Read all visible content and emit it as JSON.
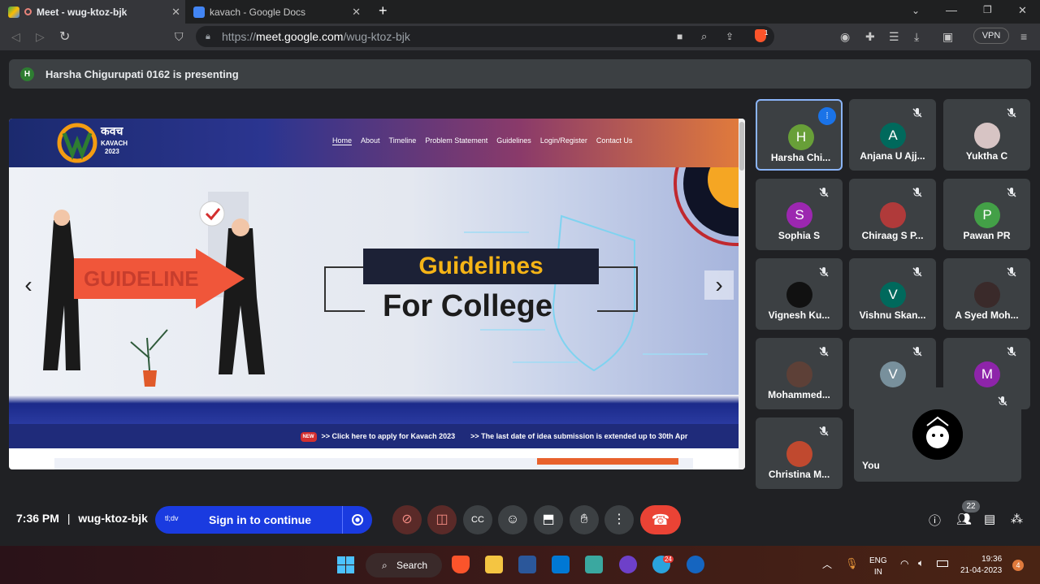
{
  "browser": {
    "tabs": [
      {
        "title": "Meet - wug-ktoz-bjk",
        "active": true
      },
      {
        "title": "kavach - Google Docs",
        "active": false
      }
    ],
    "new_tab_label": "+",
    "url_prefix": "https://",
    "url_host": "meet.google.com",
    "url_path": "/wug-ktoz-bjk",
    "vpn_label": "VPN",
    "shield_count": "1"
  },
  "banner": {
    "avatar_letter": "H",
    "text": "Harsha Chigurupati 0162 is presenting"
  },
  "slide": {
    "logo_title": "कवच",
    "logo_sub": "KAVACH",
    "logo_year": "2023",
    "nav": [
      "Home",
      "About",
      "Timeline",
      "Problem Statement",
      "Guidelines",
      "Login/Register",
      "Contact Us"
    ],
    "sign_text": "GUIDELINE",
    "heading": "Guidelines",
    "subheading": "For College",
    "new_badge": "NEW",
    "ticker_1": ">> Click here to apply for Kavach 2023",
    "ticker_2": ">> The last date of idea submission is extended up to 30th Apr"
  },
  "participants": [
    {
      "name": "Harsha Chi...",
      "letter": "H",
      "color": "#689f38",
      "speaking": true
    },
    {
      "name": "Anjana U Ajj...",
      "letter": "A",
      "color": "#00695c"
    },
    {
      "name": "Yuktha C",
      "letter": "",
      "color": "#d7c4c4"
    },
    {
      "name": "Sophia S",
      "letter": "S",
      "color": "#9c27b0"
    },
    {
      "name": "Chiraag S P...",
      "letter": "",
      "color": "#b03a3a"
    },
    {
      "name": "Pawan PR",
      "letter": "P",
      "color": "#43a047"
    },
    {
      "name": "Vignesh Ku...",
      "letter": "",
      "color": "#111111"
    },
    {
      "name": "Vishnu Skan...",
      "letter": "V",
      "color": "#00695c"
    },
    {
      "name": "A Syed Moh...",
      "letter": "",
      "color": "#3a2a2a"
    },
    {
      "name": "Mohammed...",
      "letter": "",
      "color": "#5d4037"
    },
    {
      "name": "",
      "letter": "V",
      "color": "#78909c"
    },
    {
      "name": "",
      "letter": "M",
      "color": "#8e24aa"
    },
    {
      "name": "Christina M...",
      "letter": "",
      "color": "#c0492f"
    }
  ],
  "self_tile": {
    "name": "You"
  },
  "controls": {
    "time": "7:36 PM",
    "separator": "|",
    "meeting_code": "wug-ktoz-bjk",
    "signin_small": "tl;dv",
    "signin_label": "Sign in to continue",
    "participant_count": "22"
  },
  "taskbar": {
    "search_label": "Search",
    "telegram_badge": "24",
    "lang_1": "ENG",
    "lang_2": "IN",
    "time": "19:36",
    "date": "21-04-2023",
    "notification_count": "4"
  }
}
